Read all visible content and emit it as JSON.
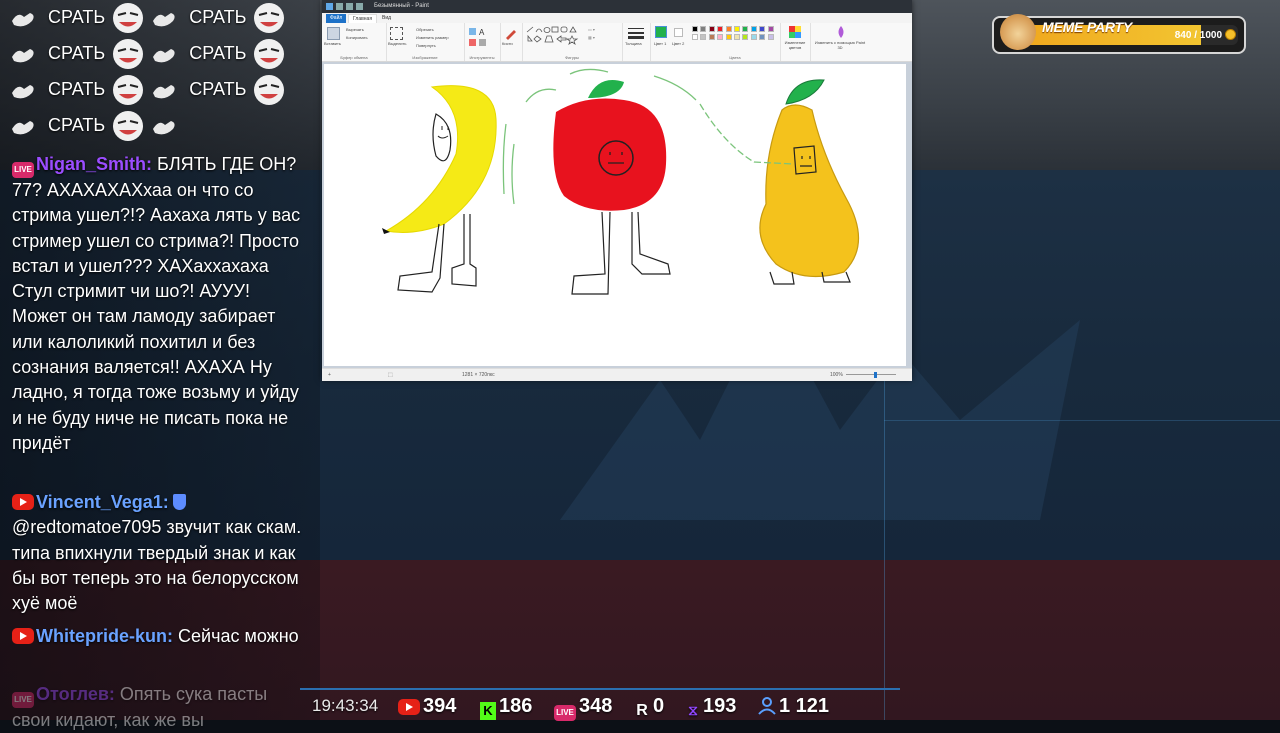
{
  "chat": {
    "emote_rows": [
      {
        "items": [
          "СРАТЬ",
          "СРАТЬ"
        ]
      },
      {
        "items": [
          "СРАТЬ",
          "СРАТЬ"
        ]
      },
      {
        "items": [
          "СРАТЬ",
          "СРАТЬ"
        ]
      },
      {
        "items": [
          "СРАТЬ"
        ]
      }
    ],
    "messages": [
      {
        "badge": "LIVE",
        "user": "Nigan_Smith:",
        "text": "БЛЯТЬ ГДЕ ОН?77? АХАХАХАХхаа он что со стрима ушел?!? Аахаха лять у вас стример ушел со стрима?! Просто встал и ушел??? ХАХаххахаха Стул стримит чи шо?! АУУУ! Может он там ламоду забирает или калоликий похитил и без сознания валяется!! АХАХА Ну ладно, я тогда тоже возьму и уйду и не буду ниче не писать пока не придёт"
      },
      {
        "badge": "YT",
        "user": "Vincent_Vega1:",
        "text": "@redtomatoe7095 звучит как скам. типа впихнули твердый знак и как бы вот теперь это на белорусском хуё моё"
      },
      {
        "badge": "YT",
        "user": "Whitepride-kun:",
        "text": "Сейчас можно"
      },
      {
        "badge": "LIVE",
        "user": "Отоглев:",
        "text": "Опять сука пасты свои кидают, как же вы"
      }
    ]
  },
  "paint": {
    "title": "Безымянный - Paint",
    "tabs": [
      "Файл",
      "Главная",
      "Вид"
    ],
    "groups": [
      "Буфер обмена",
      "Изображение",
      "Инструменты",
      "Кисти",
      "Фигуры",
      "Толщина",
      "Цвет 1",
      "Цвет 2",
      "Цвета",
      "Изменение цветов",
      "Изменить с помощью Paint 3D"
    ],
    "buttons": {
      "paste": "Вставить",
      "cut": "Вырезать",
      "copy": "Копировать",
      "select": "Выделить",
      "crop": "Обрезать",
      "resize": "Изменить размер",
      "rotate": "Повернуть"
    },
    "status": {
      "size": "1281 × 720пкс",
      "zoom": "100%"
    },
    "palette": [
      "#000000",
      "#7f7f7f",
      "#880015",
      "#ed1c24",
      "#ff7f27",
      "#fff200",
      "#22b14c",
      "#00a2e8",
      "#3f48cc",
      "#a349a4",
      "#ffffff",
      "#c3c3c3",
      "#b97a57",
      "#ffaec9",
      "#ffc90e",
      "#efe4b0",
      "#b5e61d",
      "#99d9ea",
      "#7092be",
      "#c8bfe7"
    ],
    "color1": "#22b14c",
    "color2": "#ffffff"
  },
  "widget": {
    "title": "MEME PARTY",
    "count": "840 / 1000",
    "progress": 0.84
  },
  "stats": {
    "time": "19:43:34",
    "youtube": "394",
    "kick": "186",
    "live": "348",
    "rutube": "0",
    "twitch": "193",
    "viewers": "1 121"
  }
}
